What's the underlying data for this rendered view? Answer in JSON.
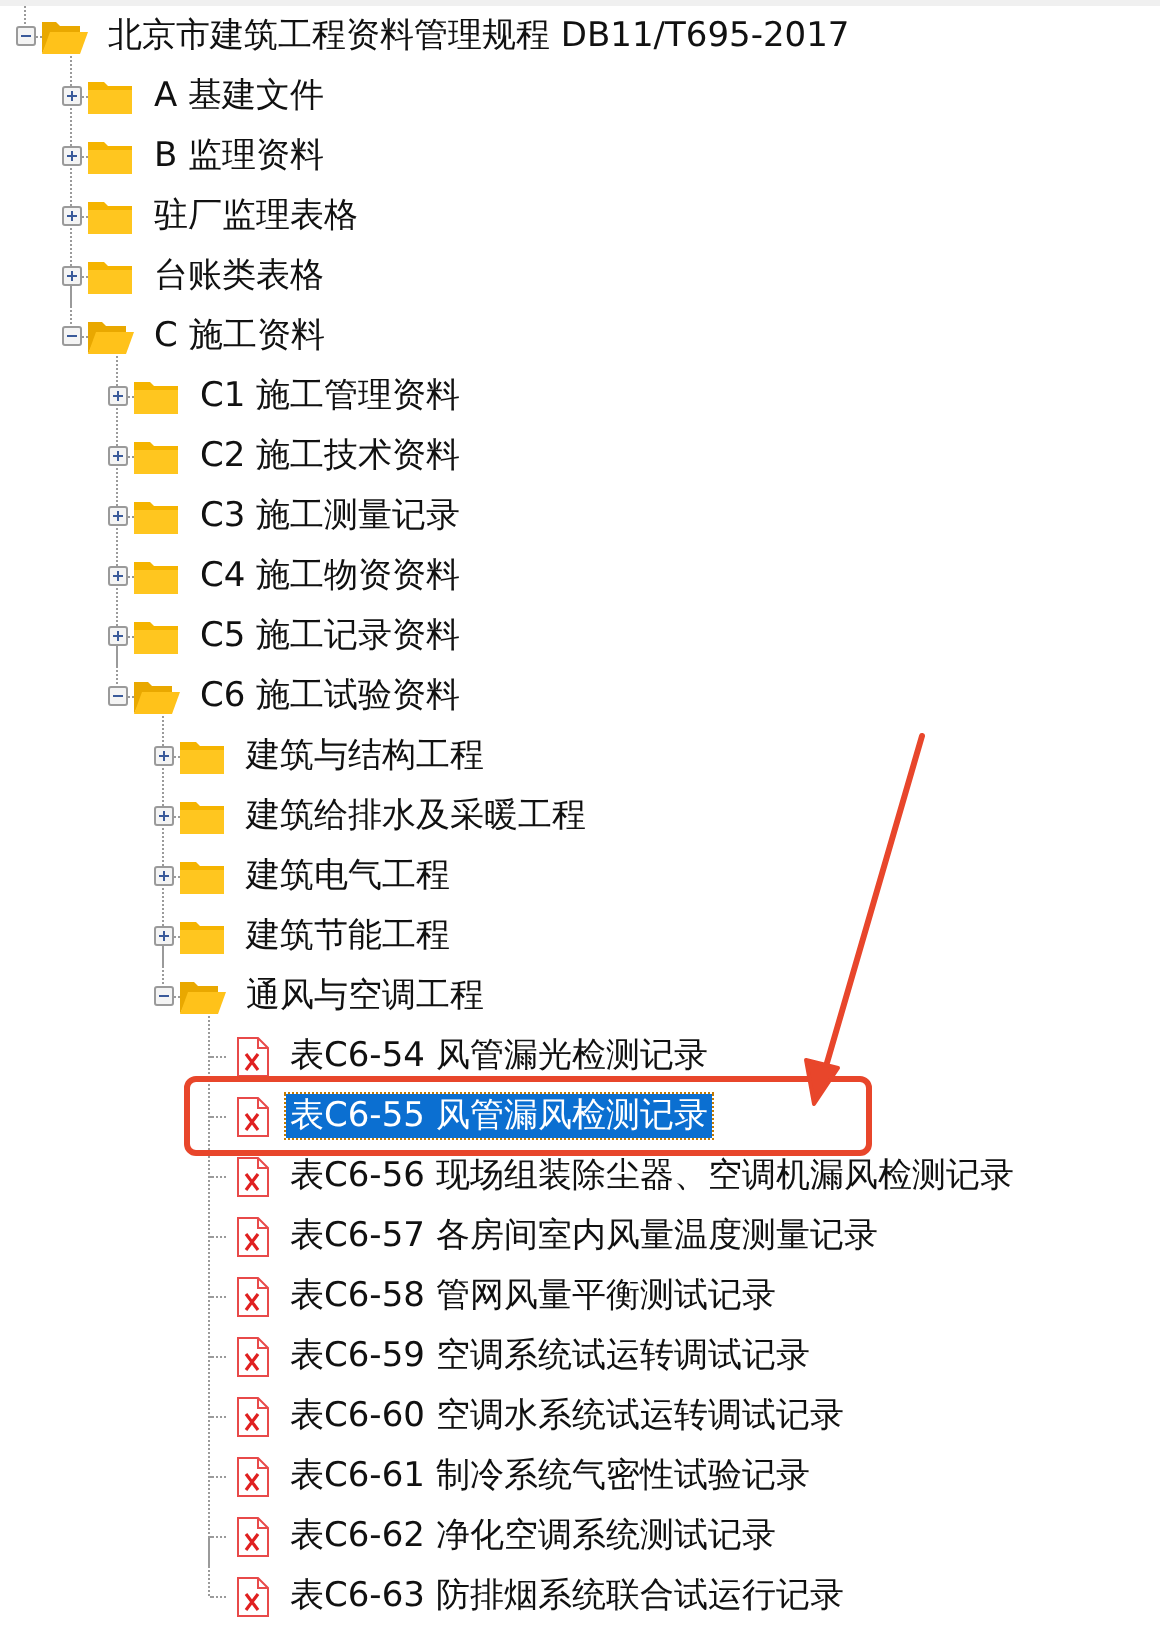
{
  "tree": [
    {
      "label": "北京市建筑工程资料管理规程 DB11/T695-2017",
      "kind": "folder",
      "expanded": true,
      "children": [
        {
          "label": "A 基建文件",
          "kind": "folder",
          "expanded": false
        },
        {
          "label": "B 监理资料",
          "kind": "folder",
          "expanded": false
        },
        {
          "label": "驻厂监理表格",
          "kind": "folder",
          "expanded": false
        },
        {
          "label": "台账类表格",
          "kind": "folder",
          "expanded": false
        },
        {
          "label": "C 施工资料",
          "kind": "folder",
          "expanded": true,
          "children": [
            {
              "label": "C1 施工管理资料",
              "kind": "folder",
              "expanded": false
            },
            {
              "label": "C2 施工技术资料",
              "kind": "folder",
              "expanded": false
            },
            {
              "label": "C3 施工测量记录",
              "kind": "folder",
              "expanded": false
            },
            {
              "label": "C4 施工物资资料",
              "kind": "folder",
              "expanded": false
            },
            {
              "label": "C5 施工记录资料",
              "kind": "folder",
              "expanded": false
            },
            {
              "label": "C6 施工试验资料",
              "kind": "folder",
              "expanded": true,
              "children": [
                {
                  "label": "建筑与结构工程",
                  "kind": "folder",
                  "expanded": false
                },
                {
                  "label": "建筑给排水及采暖工程",
                  "kind": "folder",
                  "expanded": false
                },
                {
                  "label": "建筑电气工程",
                  "kind": "folder",
                  "expanded": false
                },
                {
                  "label": "建筑节能工程",
                  "kind": "folder",
                  "expanded": false
                },
                {
                  "label": "通风与空调工程",
                  "kind": "folder",
                  "expanded": true,
                  "children": [
                    {
                      "label": "表C6-54 风管漏光检测记录",
                      "kind": "file",
                      "selected": false,
                      "annotated": false
                    },
                    {
                      "label": "表C6-55 风管漏风检测记录",
                      "kind": "file",
                      "selected": true,
                      "annotated": true
                    },
                    {
                      "label": "表C6-56 现场组装除尘器、空调机漏风检测记录",
                      "kind": "file",
                      "selected": false,
                      "annotated": false
                    },
                    {
                      "label": "表C6-57 各房间室内风量温度测量记录",
                      "kind": "file",
                      "selected": false,
                      "annotated": false
                    },
                    {
                      "label": "表C6-58 管网风量平衡测试记录",
                      "kind": "file",
                      "selected": false,
                      "annotated": false
                    },
                    {
                      "label": "表C6-59 空调系统试运转调试记录",
                      "kind": "file",
                      "selected": false,
                      "annotated": false
                    },
                    {
                      "label": "表C6-60 空调水系统试运转调试记录",
                      "kind": "file",
                      "selected": false,
                      "annotated": false
                    },
                    {
                      "label": "表C6-61 制冷系统气密性试验记录",
                      "kind": "file",
                      "selected": false,
                      "annotated": false
                    },
                    {
                      "label": "表C6-62 净化空调系统测试记录",
                      "kind": "file",
                      "selected": false,
                      "annotated": false
                    },
                    {
                      "label": "表C6-63 防排烟系统联合试运行记录",
                      "kind": "file",
                      "selected": false,
                      "annotated": false
                    }
                  ]
                }
              ]
            }
          ]
        }
      ]
    }
  ]
}
